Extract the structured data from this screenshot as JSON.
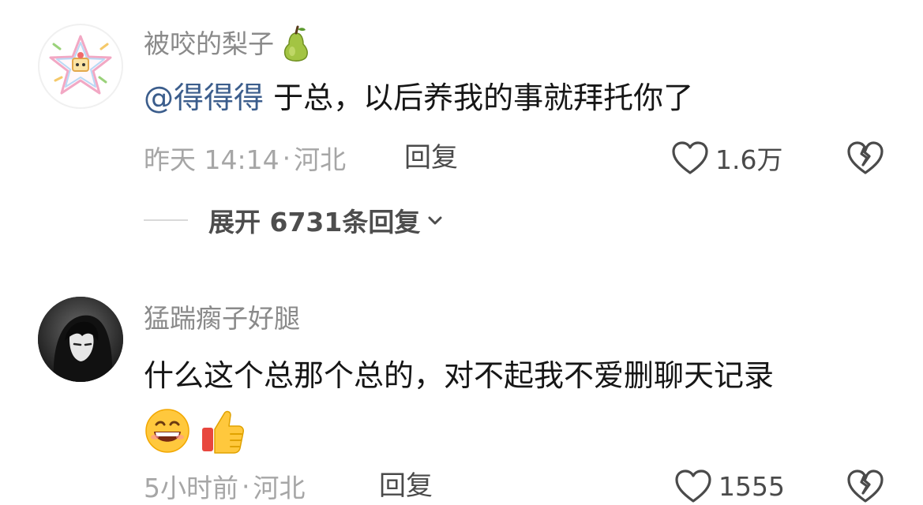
{
  "comments": [
    {
      "username": "被咬的梨子",
      "username_emoji": "pear-emoji",
      "mention": "@得得得",
      "text": " 于总，以后养我的事就拜托你了",
      "time": "昨天 14:14",
      "separator": "·",
      "location": "河北",
      "reply_label": "回复",
      "like_count": "1.6万",
      "expand_label": "展开 6731条回复"
    },
    {
      "username": "猛踹瘸子好腿",
      "text": "什么这个总那个总的，对不起我不爱删聊天记录",
      "emojis": [
        "grinning-face-emoji",
        "thumbs-up-emoji"
      ],
      "time": "5小时前",
      "separator": "·",
      "location": "河北",
      "reply_label": "回复",
      "like_count": "1555"
    }
  ],
  "colors": {
    "mention": "#3b5d8c",
    "username": "#8a8a8a",
    "meta": "#a6a6a6",
    "body_text": "#161616"
  }
}
